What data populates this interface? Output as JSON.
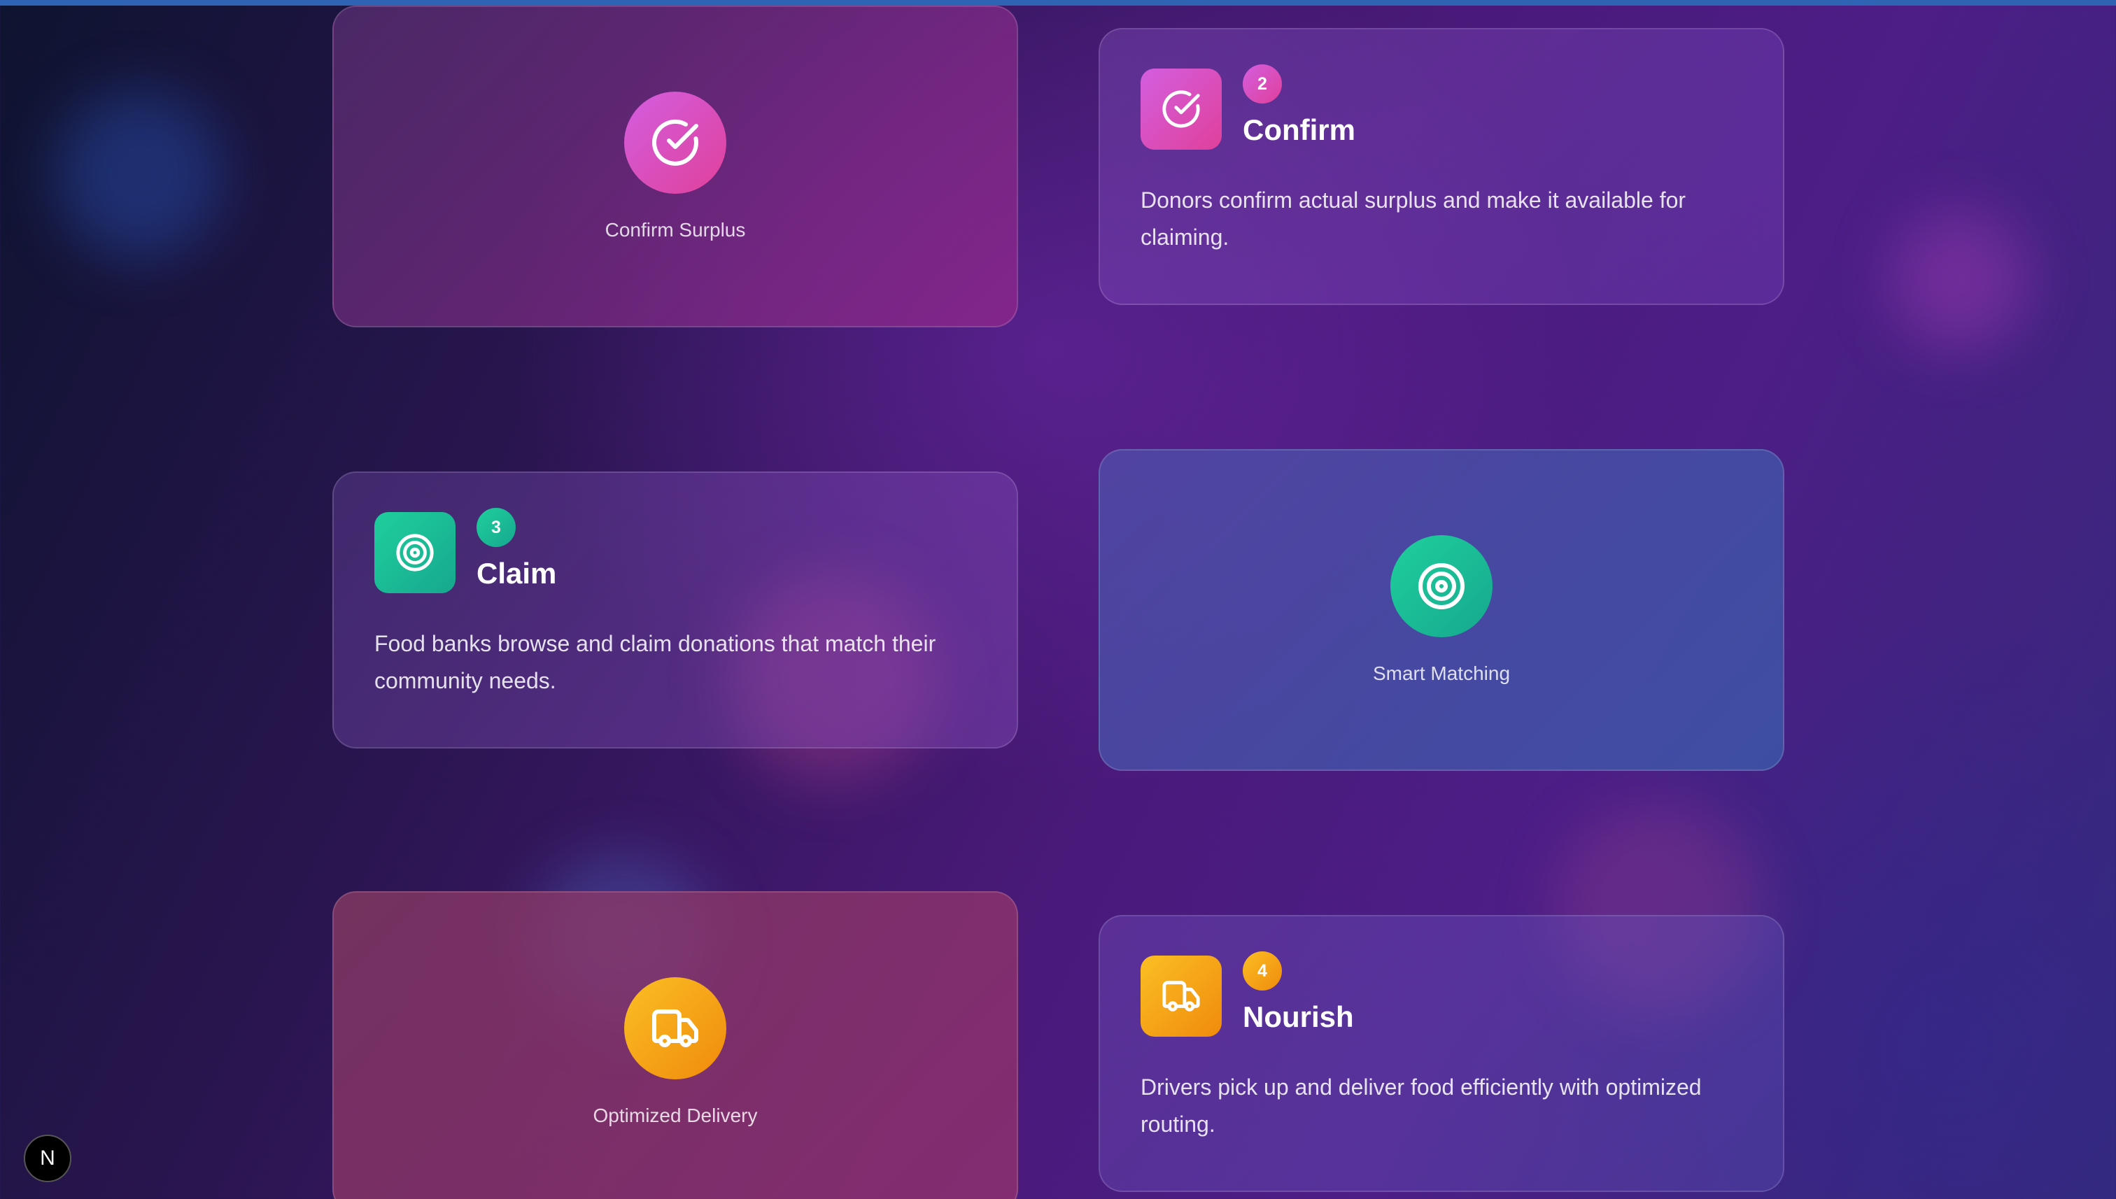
{
  "cards": [
    {
      "caption": "Confirm Surplus",
      "icon": "check-circle-icon"
    },
    {
      "step": "2",
      "title": "Confirm",
      "description": "Donors confirm actual surplus and make it available for claiming.",
      "icon": "check-circle-icon",
      "accent": "#d94fc0"
    },
    {
      "step": "3",
      "title": "Claim",
      "description": "Food banks browse and claim donations that match their community needs.",
      "icon": "target-icon",
      "accent": "#1bc39a"
    },
    {
      "caption": "Smart Matching",
      "icon": "target-icon"
    },
    {
      "caption": "Optimized Delivery",
      "icon": "truck-icon"
    },
    {
      "step": "4",
      "title": "Nourish",
      "description": "Drivers pick up and deliver food efficiently with optimized routing.",
      "icon": "truck-icon",
      "accent": "#f59e0b"
    }
  ],
  "badge": {
    "letter": "N"
  }
}
